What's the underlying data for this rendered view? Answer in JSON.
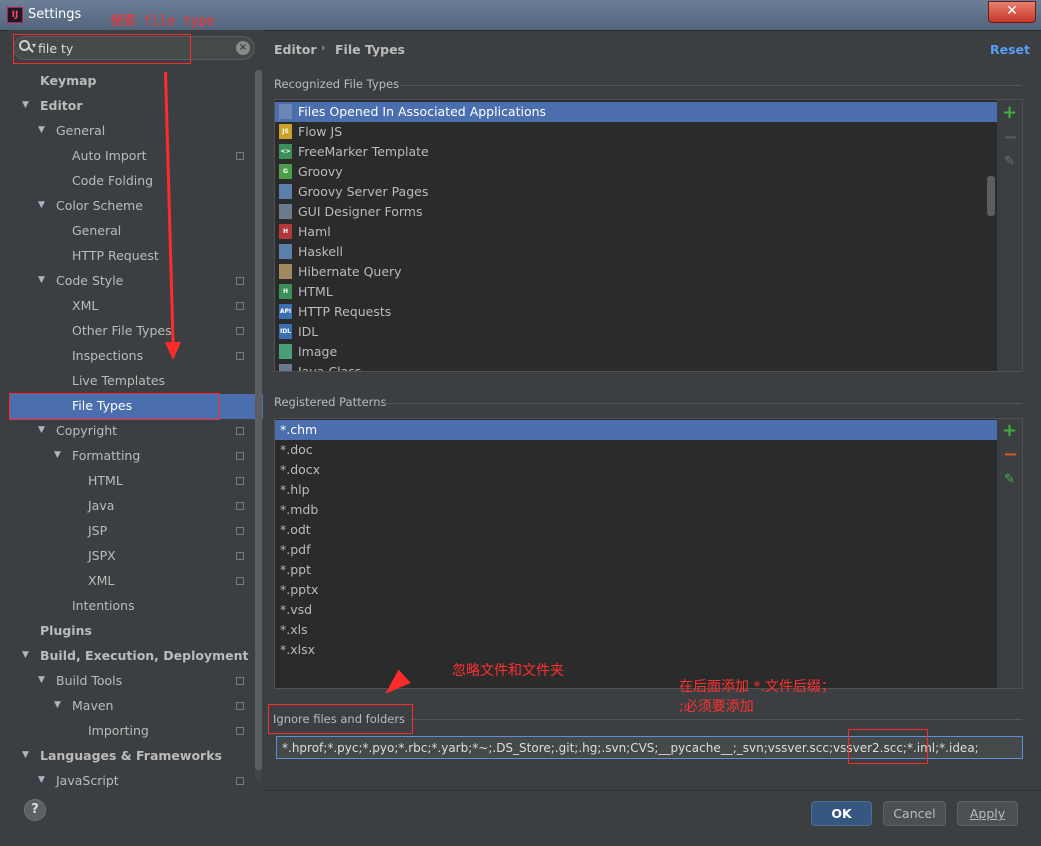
{
  "window": {
    "title": "Settings",
    "app_icon": "intellij-icon",
    "close_label": "✕"
  },
  "search": {
    "value": "file ty"
  },
  "tree": [
    {
      "label": "Keymap",
      "level": 0,
      "bold": true,
      "arrow": false,
      "proj": false
    },
    {
      "label": "Editor",
      "level": 0,
      "bold": true,
      "arrow": true,
      "proj": false
    },
    {
      "label": "General",
      "level": 1,
      "bold": false,
      "arrow": true,
      "proj": false
    },
    {
      "label": "Auto Import",
      "level": 3,
      "bold": false,
      "arrow": false,
      "proj": true
    },
    {
      "label": "Code Folding",
      "level": 3,
      "bold": false,
      "arrow": false,
      "proj": false
    },
    {
      "label": "Color Scheme",
      "level": 1,
      "bold": false,
      "arrow": true,
      "proj": false
    },
    {
      "label": "General",
      "level": 3,
      "bold": false,
      "arrow": false,
      "proj": false
    },
    {
      "label": "HTTP Request",
      "level": 3,
      "bold": false,
      "arrow": false,
      "proj": false
    },
    {
      "label": "Code Style",
      "level": 1,
      "bold": false,
      "arrow": true,
      "proj": true
    },
    {
      "label": "XML",
      "level": 3,
      "bold": false,
      "arrow": false,
      "proj": true
    },
    {
      "label": "Other File Types",
      "level": 3,
      "bold": false,
      "arrow": false,
      "proj": true
    },
    {
      "label": "Inspections",
      "level": 2,
      "bold": false,
      "arrow": false,
      "proj": true
    },
    {
      "label": "Live Templates",
      "level": 2,
      "bold": false,
      "arrow": false,
      "proj": false
    },
    {
      "label": "File Types",
      "level": 2,
      "bold": false,
      "arrow": false,
      "proj": false,
      "selected": true
    },
    {
      "label": "Copyright",
      "level": 1,
      "bold": false,
      "arrow": true,
      "proj": true
    },
    {
      "label": "Formatting",
      "level": 2,
      "bold": false,
      "arrow": true,
      "proj": true
    },
    {
      "label": "HTML",
      "level": 4,
      "bold": false,
      "arrow": false,
      "proj": true
    },
    {
      "label": "Java",
      "level": 4,
      "bold": false,
      "arrow": false,
      "proj": true
    },
    {
      "label": "JSP",
      "level": 4,
      "bold": false,
      "arrow": false,
      "proj": true
    },
    {
      "label": "JSPX",
      "level": 4,
      "bold": false,
      "arrow": false,
      "proj": true
    },
    {
      "label": "XML",
      "level": 4,
      "bold": false,
      "arrow": false,
      "proj": true
    },
    {
      "label": "Intentions",
      "level": 2,
      "bold": false,
      "arrow": false,
      "proj": false
    },
    {
      "label": "Plugins",
      "level": 0,
      "bold": true,
      "arrow": false,
      "proj": false
    },
    {
      "label": "Build, Execution, Deployment",
      "level": 0,
      "bold": true,
      "arrow": true,
      "proj": false
    },
    {
      "label": "Build Tools",
      "level": 1,
      "bold": false,
      "arrow": true,
      "proj": true
    },
    {
      "label": "Maven",
      "level": 2,
      "bold": false,
      "arrow": true,
      "proj": true
    },
    {
      "label": "Importing",
      "level": 4,
      "bold": false,
      "arrow": false,
      "proj": true
    },
    {
      "label": "Languages & Frameworks",
      "level": 0,
      "bold": true,
      "arrow": true,
      "proj": false
    },
    {
      "label": "JavaScript",
      "level": 1,
      "bold": false,
      "arrow": true,
      "proj": true
    }
  ],
  "breadcrumb": {
    "parent": "Editor",
    "separator": "›",
    "page": "File Types"
  },
  "reset_label": "Reset",
  "recognized": {
    "title": "Recognized File Types",
    "items": [
      {
        "label": "Files Opened In Associated Applications",
        "icon": "associated-apps-icon",
        "color": "#6a87b5",
        "tag": ""
      },
      {
        "label": "Flow JS",
        "icon": "js-file-icon",
        "color": "#c9a227",
        "tag": "JS"
      },
      {
        "label": "FreeMarker Template",
        "icon": "freemarker-icon",
        "color": "#3d8f5a",
        "tag": "<>"
      },
      {
        "label": "Groovy",
        "icon": "groovy-icon",
        "color": "#4a9e4a",
        "tag": "G"
      },
      {
        "label": "Groovy Server Pages",
        "icon": "gsp-icon",
        "color": "#5a7fa8",
        "tag": ""
      },
      {
        "label": "GUI Designer Forms",
        "icon": "gui-form-icon",
        "color": "#6c7b8b",
        "tag": ""
      },
      {
        "label": "Haml",
        "icon": "haml-icon",
        "color": "#b03a3a",
        "tag": "H"
      },
      {
        "label": "Haskell",
        "icon": "haskell-icon",
        "color": "#5a7fa8",
        "tag": ""
      },
      {
        "label": "Hibernate Query",
        "icon": "hibernate-icon",
        "color": "#a08860",
        "tag": ""
      },
      {
        "label": "HTML",
        "icon": "html-icon",
        "color": "#3d8f5a",
        "tag": "H"
      },
      {
        "label": "HTTP Requests",
        "icon": "http-request-icon",
        "color": "#3a6fb0",
        "tag": "API"
      },
      {
        "label": "IDL",
        "icon": "idl-icon",
        "color": "#3a6fb0",
        "tag": "IDL"
      },
      {
        "label": "Image",
        "icon": "image-icon",
        "color": "#4a9e7a",
        "tag": ""
      },
      {
        "label": "Java Class",
        "icon": "java-class-icon",
        "color": "#6c7b8b",
        "tag": ""
      }
    ]
  },
  "patterns": {
    "title": "Registered Patterns",
    "items": [
      "*.chm",
      "*.doc",
      "*.docx",
      "*.hlp",
      "*.mdb",
      "*.odt",
      "*.pdf",
      "*.ppt",
      "*.pptx",
      "*.vsd",
      "*.xls",
      "*.xlsx"
    ]
  },
  "ignore": {
    "title": "Ignore files and folders",
    "value": "*.hprof;*.pyc;*.pyo;*.rbc;*.yarb;*~;.DS_Store;.git;.hg;.svn;CVS;__pycache__;_svn;vssver.scc;vssver2.scc;*.iml;*.idea;"
  },
  "buttons": {
    "help": "?",
    "ok": "OK",
    "cancel": "Cancel",
    "apply": "Apply"
  },
  "annotations": {
    "search_note": "搜索 file type",
    "ignore_note": "忽略文件和文件夹",
    "add_note_1": "在后面添加 *.文件后缀；",
    "add_note_2": ";必须要添加"
  },
  "colors": {
    "accent": "#4b6eaf",
    "link": "#589df6",
    "annotation": "#ff2a2a",
    "add": "#3fae3f",
    "remove": "#d9552b"
  }
}
